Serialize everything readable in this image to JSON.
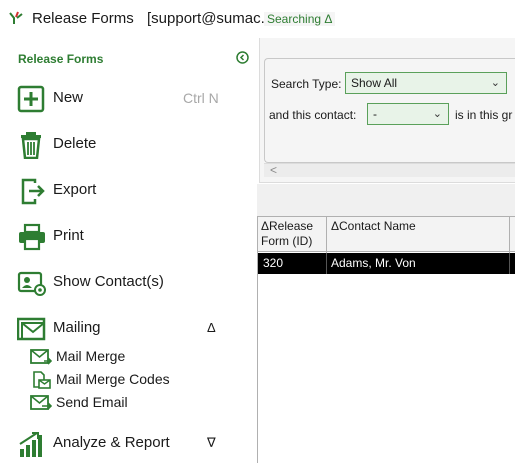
{
  "titlebar": {
    "app_name": "Release Forms",
    "user": "[support@sumac.com]",
    "icon": "sumac-logo-icon"
  },
  "sidebar": {
    "title": "Release Forms",
    "collapse_icon": "collapse-arrow-icon",
    "items": [
      {
        "label": "New",
        "icon": "plus-square-icon",
        "shortcut": "Ctrl N"
      },
      {
        "label": "Delete",
        "icon": "trash-icon"
      },
      {
        "label": "Export",
        "icon": "export-icon"
      },
      {
        "label": "Print",
        "icon": "printer-icon"
      },
      {
        "label": "Show Contact(s)",
        "icon": "contact-card-icon"
      },
      {
        "label": "Mailing",
        "icon": "envelope-icon",
        "caret": "Δ"
      },
      {
        "label": "Analyze & Report",
        "icon": "bar-chart-icon",
        "caret": "∇"
      }
    ],
    "mailing_sub": [
      {
        "label": "Mail Merge",
        "icon": "mail-merge-icon"
      },
      {
        "label": "Mail Merge Codes",
        "icon": "mail-merge-codes-icon"
      },
      {
        "label": "Send Email",
        "icon": "send-email-icon"
      }
    ]
  },
  "search": {
    "legend": "Searching Δ",
    "search_type_label": "Search Type:",
    "search_type_value": "Show All",
    "contact_label": "and this contact:",
    "contact_value": "-",
    "contact_suffix": "is in this gr",
    "scroll_left": "<"
  },
  "grid": {
    "columns": [
      {
        "label": "ΔRelease Form (ID)"
      },
      {
        "label": "ΔContact Name"
      }
    ],
    "rows": [
      {
        "id": "320",
        "contact": "Adams, Mr. Von"
      }
    ]
  },
  "colors": {
    "accent": "#2e7d32",
    "selected_row": "#000000"
  }
}
